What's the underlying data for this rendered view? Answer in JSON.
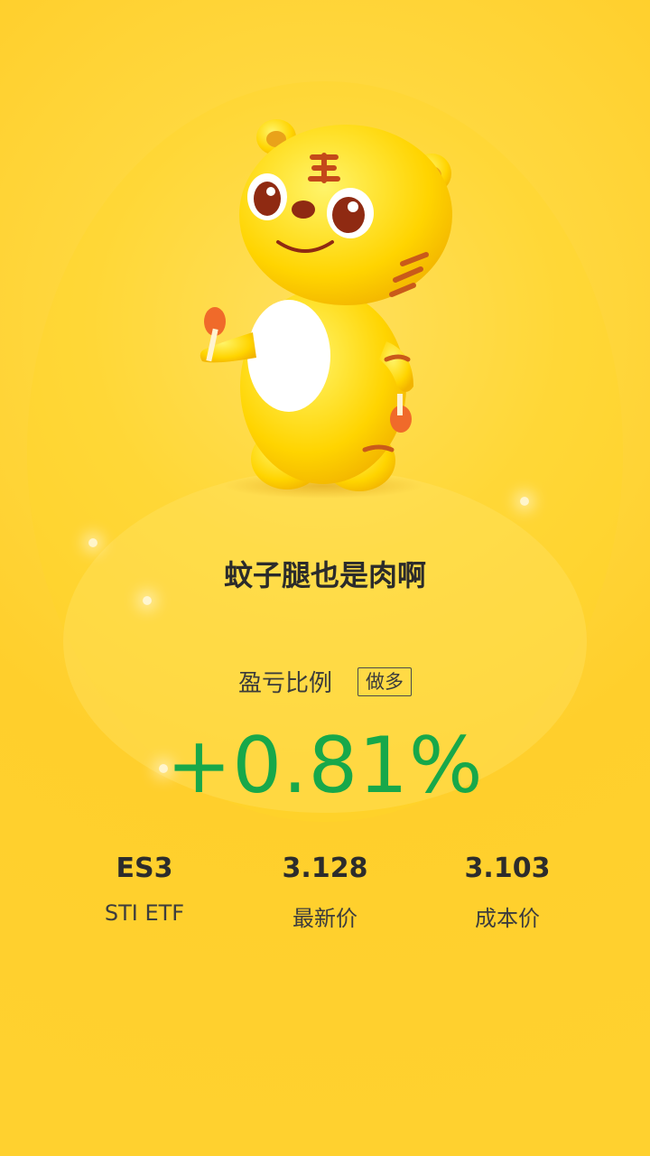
{
  "card": {
    "title": "蚊子腿也是肉啊",
    "ratio_label": "盈亏比例",
    "direction": "做多",
    "percent": "+0.81%",
    "percent_color": "#17a84a",
    "stats": [
      {
        "value": "ES3",
        "label": "STI ETF"
      },
      {
        "value": "3.128",
        "label": "最新价"
      },
      {
        "value": "3.103",
        "label": "成本价"
      }
    ]
  },
  "icons": {
    "mascot": "tiger-mascot-icon"
  },
  "colors": {
    "background": "#ffd33a",
    "text": "#2b2b2b"
  }
}
